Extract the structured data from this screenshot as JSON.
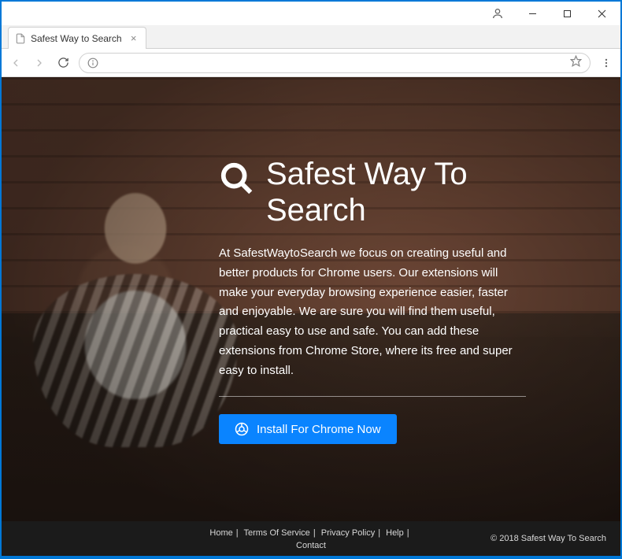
{
  "window": {
    "tab_title": "Safest Way to Search"
  },
  "hero": {
    "title": "Safest Way To Search",
    "body": "At SafestWaytoSearch we focus on creating useful and better products for Chrome users. Our extensions will make your everyday browsing experience easier, faster and enjoyable. We are sure you will find them useful, practical easy to use and safe. You can add these extensions from Chrome Store, where its free and super easy to install.",
    "cta_label": "Install For Chrome Now"
  },
  "footer": {
    "links": {
      "home": "Home",
      "tos": "Terms Of Service",
      "privacy": "Privacy Policy",
      "help": "Help",
      "contact": "Contact"
    },
    "copyright": "© 2018 Safest Way To Search"
  }
}
